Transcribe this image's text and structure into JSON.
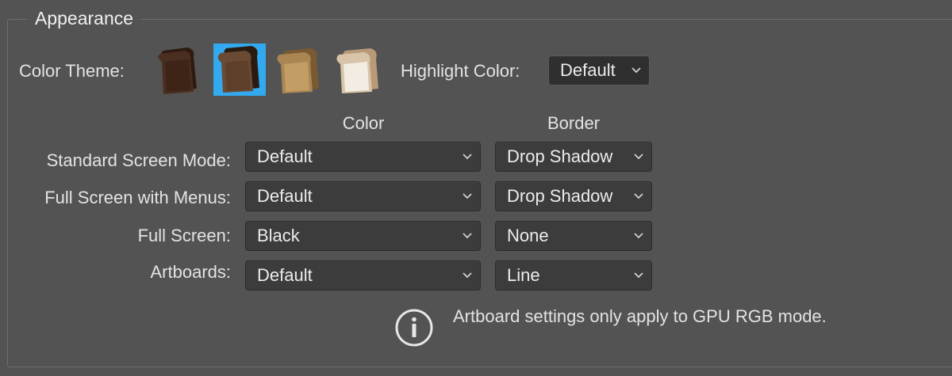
{
  "group": {
    "title": "Appearance"
  },
  "color_theme": {
    "label": "Color Theme:",
    "selected_index": 1,
    "swatches": [
      {
        "name": "darkest",
        "color": "#4a2e1f"
      },
      {
        "name": "dark",
        "color": "#6b4a33"
      },
      {
        "name": "medium",
        "color": "#a98654"
      },
      {
        "name": "light",
        "color": "#e8dccb"
      }
    ],
    "selection_color": "#33aaf0"
  },
  "highlight_color": {
    "label": "Highlight Color:",
    "value": "Default"
  },
  "columns": {
    "color": "Color",
    "border": "Border"
  },
  "rows": [
    {
      "label": "Standard Screen Mode:",
      "color": "Default",
      "border": "Drop Shadow"
    },
    {
      "label": "Full Screen with Menus:",
      "color": "Default",
      "border": "Drop Shadow"
    },
    {
      "label": "Full Screen:",
      "color": "Black",
      "border": "None"
    },
    {
      "label": "Artboards:",
      "color": "Default",
      "border": "Line"
    }
  ],
  "info": {
    "icon": "info-icon",
    "text": "Artboard settings only apply to GPU RGB mode."
  }
}
